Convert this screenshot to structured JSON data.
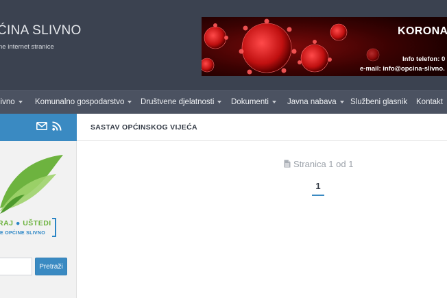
{
  "header": {
    "site_title": "ĆINA SLIVNO",
    "site_subtitle": "ne internet stranice"
  },
  "banner": {
    "title": "KORONA",
    "phone": "Info telefon: 0",
    "email": "e-mail: info@opcina-slivno."
  },
  "nav": {
    "items": [
      {
        "label": "livno",
        "dropdown": true
      },
      {
        "label": "Komunalno gospodarstvo",
        "dropdown": true
      },
      {
        "label": "Društvene djelatnosti",
        "dropdown": true
      },
      {
        "label": "Dokumenti",
        "dropdown": true
      },
      {
        "label": "Javna nabava",
        "dropdown": true
      },
      {
        "label": "Službeni glasnik",
        "dropdown": false
      },
      {
        "label": "Kontakt",
        "dropdown": false
      }
    ]
  },
  "sidebar": {
    "logo_text_1a": "RAJ",
    "logo_text_1b": "UŠTEDI",
    "logo_text_2": "E OPĆINE SLIVNO",
    "search_placeholder": "",
    "search_button": "Pretraži"
  },
  "main": {
    "section_title": "SASTAV OPĆINSKOG VIJEĆA",
    "page_info": "Stranica 1 od 1",
    "current_page": "1"
  },
  "colors": {
    "header_bg": "#3b4250",
    "nav_bg": "#4b5261",
    "accent": "#3a8ac2",
    "logo_green": "#6db33f"
  }
}
